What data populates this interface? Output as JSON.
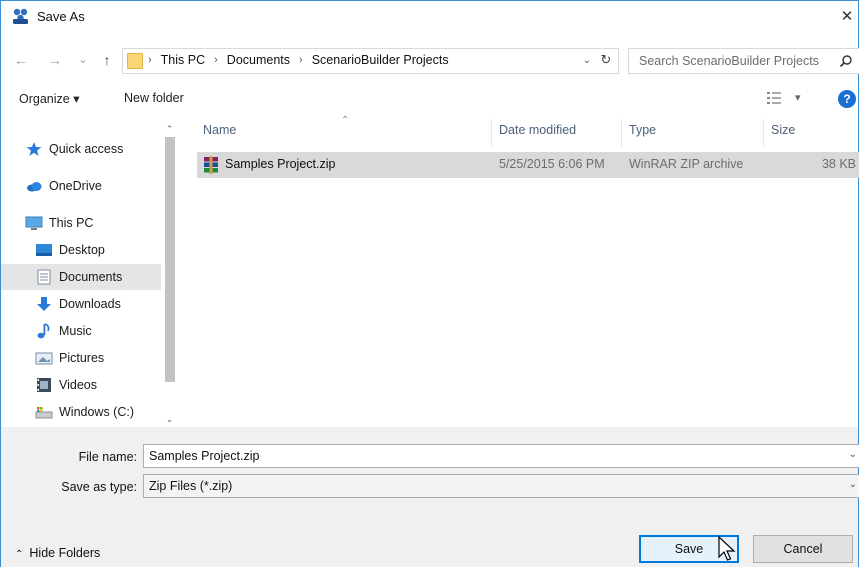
{
  "window": {
    "title": "Save As",
    "close_glyph": "✕"
  },
  "address_bar": {
    "crumbs": [
      "This PC",
      "Documents",
      "ScenarioBuilder Projects"
    ],
    "crumb_separator": "›",
    "dropdown_glyph": "⌄",
    "refresh_glyph": "↻"
  },
  "nav_buttons": {
    "back": "←",
    "forward": "→",
    "recent": "⌄",
    "up": "↑"
  },
  "search": {
    "placeholder": "Search ScenarioBuilder Projects"
  },
  "toolbar": {
    "organize": "Organize ▾",
    "new_folder": "New folder",
    "view_glyph": "▾",
    "help": "?"
  },
  "nav_pane": {
    "items": [
      {
        "label": "Quick access",
        "icon": "star-icon"
      },
      {
        "label": "OneDrive",
        "icon": "cloud-icon"
      },
      {
        "label": "This PC",
        "icon": "computer-icon"
      },
      {
        "label": "Desktop",
        "icon": "desktop-icon"
      },
      {
        "label": "Documents",
        "icon": "documents-icon",
        "selected": true
      },
      {
        "label": "Downloads",
        "icon": "download-icon"
      },
      {
        "label": "Music",
        "icon": "music-icon"
      },
      {
        "label": "Pictures",
        "icon": "pictures-icon"
      },
      {
        "label": "Videos",
        "icon": "videos-icon"
      },
      {
        "label": "Windows (C:)",
        "icon": "drive-icon"
      }
    ],
    "scroll_up": "⌃",
    "scroll_down": "⌄"
  },
  "file_list": {
    "columns": [
      "Name",
      "Date modified",
      "Type",
      "Size"
    ],
    "sort_glyph": "⌃",
    "rows": [
      {
        "name": "Samples Project.zip",
        "date": "5/25/2015 6:06 PM",
        "type": "WinRAR ZIP archive",
        "size": "38 KB"
      }
    ]
  },
  "fields": {
    "file_name_label": "File name:",
    "file_name_value": "Samples Project.zip",
    "save_type_label": "Save as type:",
    "save_type_value": "Zip Files (*.zip)",
    "drop_glyph": "⌄"
  },
  "footer": {
    "hide_folders": "Hide Folders",
    "hide_glyph": "⌃",
    "save": "Save",
    "cancel": "Cancel"
  },
  "colors": {
    "accent": "#0078d7",
    "selection": "#d9d9d9",
    "help": "#1b6fd1",
    "folder": "#f9d575"
  }
}
